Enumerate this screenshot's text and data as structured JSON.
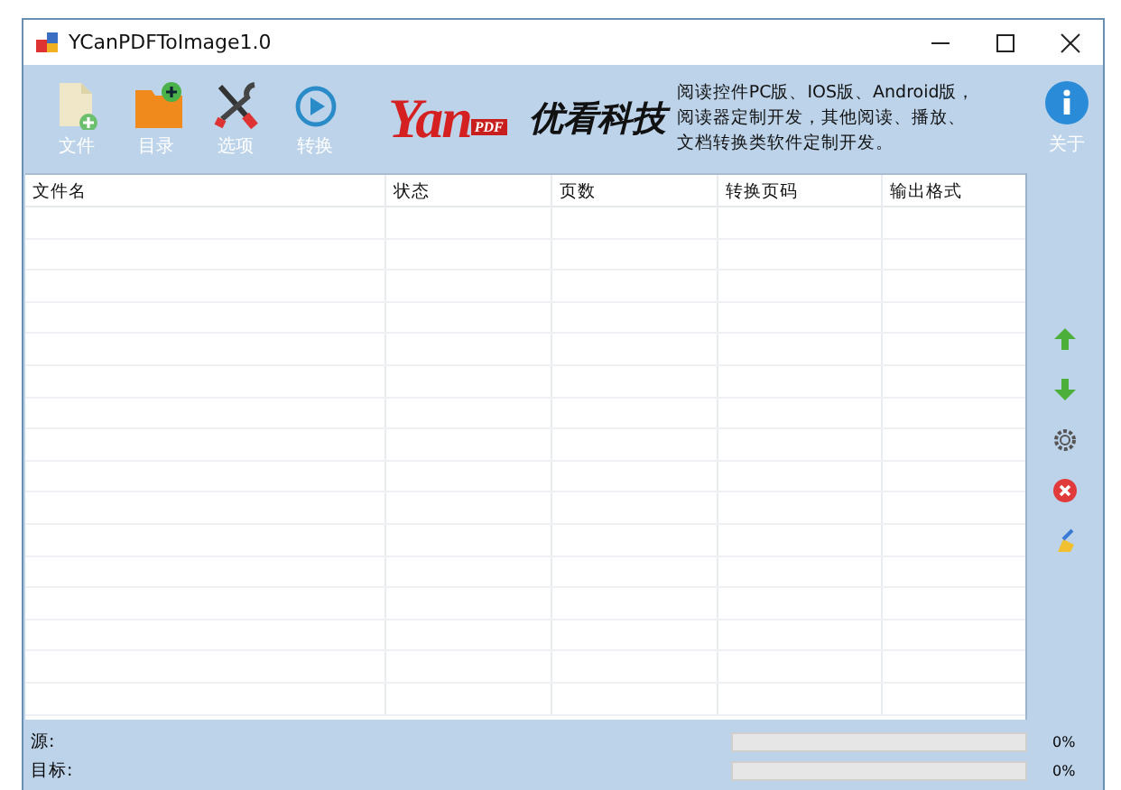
{
  "window": {
    "title": "YCanPDFToImage1.0"
  },
  "toolbar": {
    "buttons": [
      {
        "kind": "file",
        "label": "文件"
      },
      {
        "kind": "folder",
        "label": "目录"
      },
      {
        "kind": "tools",
        "label": "选项"
      },
      {
        "kind": "play",
        "label": "转换"
      }
    ],
    "logo": {
      "text": "Yan",
      "badge": "PDF"
    },
    "brand": "优看科技",
    "description": [
      "阅读控件PC版、IOS版、Android版，",
      "阅读器定制开发，其他阅读、播放、",
      "文档转换类软件定制开发。"
    ],
    "about": {
      "label": "关于"
    }
  },
  "table": {
    "columns": [
      "文件名",
      "状态",
      "页数",
      "转换页码",
      "输出格式"
    ]
  },
  "side_tools": [
    {
      "kind": "up"
    },
    {
      "kind": "down"
    },
    {
      "kind": "gear"
    },
    {
      "kind": "delete"
    },
    {
      "kind": "clear"
    }
  ],
  "status": [
    {
      "label": "源:",
      "level": 0,
      "reading": "0%"
    },
    {
      "label": "目标:",
      "level": 0,
      "reading": "0%"
    }
  ]
}
